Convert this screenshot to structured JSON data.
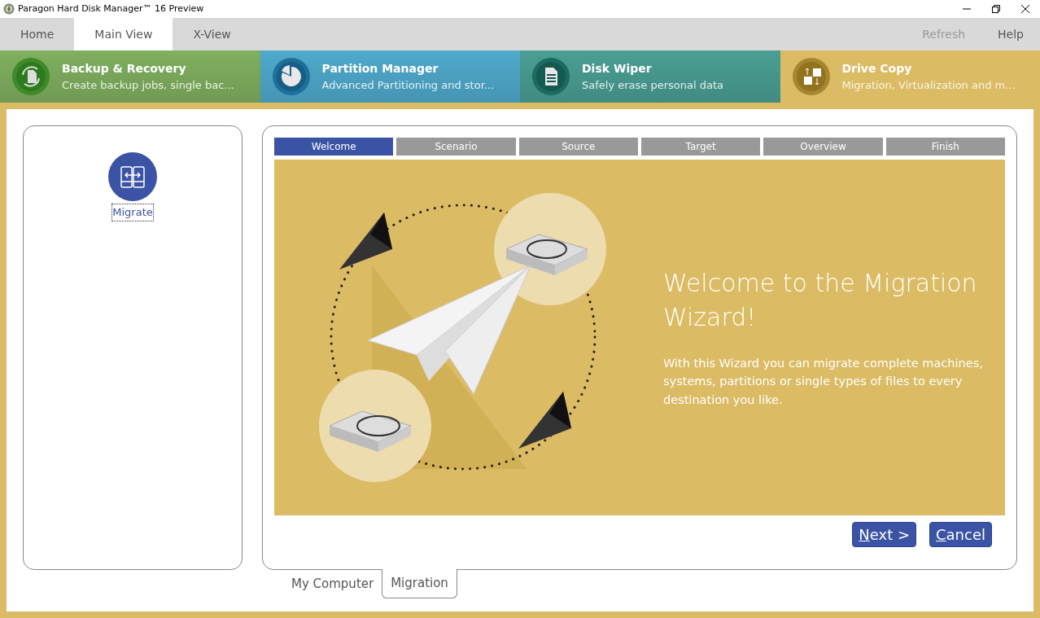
{
  "window": {
    "title": "Paragon Hard Disk Manager™ 16 Preview"
  },
  "menu_tabs": [
    {
      "label": "Home",
      "selected": false
    },
    {
      "label": "Main View",
      "selected": true
    },
    {
      "label": "X-View",
      "selected": false
    }
  ],
  "menu_actions": [
    {
      "label": "Refresh",
      "disabled": true
    },
    {
      "label": "Help",
      "disabled": false
    }
  ],
  "modules": [
    {
      "kind": "backup",
      "title": "Backup & Recovery",
      "subtitle": "Create backup jobs, single bac...",
      "color": "#7faf5f",
      "selected": false
    },
    {
      "kind": "partition",
      "title": "Partition Manager",
      "subtitle": "Advanced Partitioning and stor...",
      "color": "#4fa9cc",
      "selected": false
    },
    {
      "kind": "wiper",
      "title": "Disk Wiper",
      "subtitle": "Safely erase personal data",
      "color": "#4a9e93",
      "selected": false
    },
    {
      "kind": "copy",
      "title": "Drive Copy",
      "subtitle": "Migration, Virtualization and m...",
      "color": "#dbbb63",
      "selected": true
    }
  ],
  "sidebar": {
    "items": [
      {
        "label": "Migrate",
        "selected": true
      }
    ]
  },
  "wizard": {
    "steps": [
      {
        "label": "Welcome",
        "selected": true
      },
      {
        "label": "Scenario",
        "selected": false
      },
      {
        "label": "Source",
        "selected": false
      },
      {
        "label": "Target",
        "selected": false
      },
      {
        "label": "Overview",
        "selected": false
      },
      {
        "label": "Finish",
        "selected": false
      }
    ],
    "heading": "Welcome to the Migration Wizard!",
    "description": "With this Wizard you can migrate complete machines, systems, partitions or single types of files to every destination you like.",
    "buttons": [
      "Next >",
      "Cancel"
    ]
  },
  "bottom_tabs": [
    {
      "label": "My Computer",
      "selected": false
    },
    {
      "label": "Migration",
      "selected": true
    }
  ]
}
